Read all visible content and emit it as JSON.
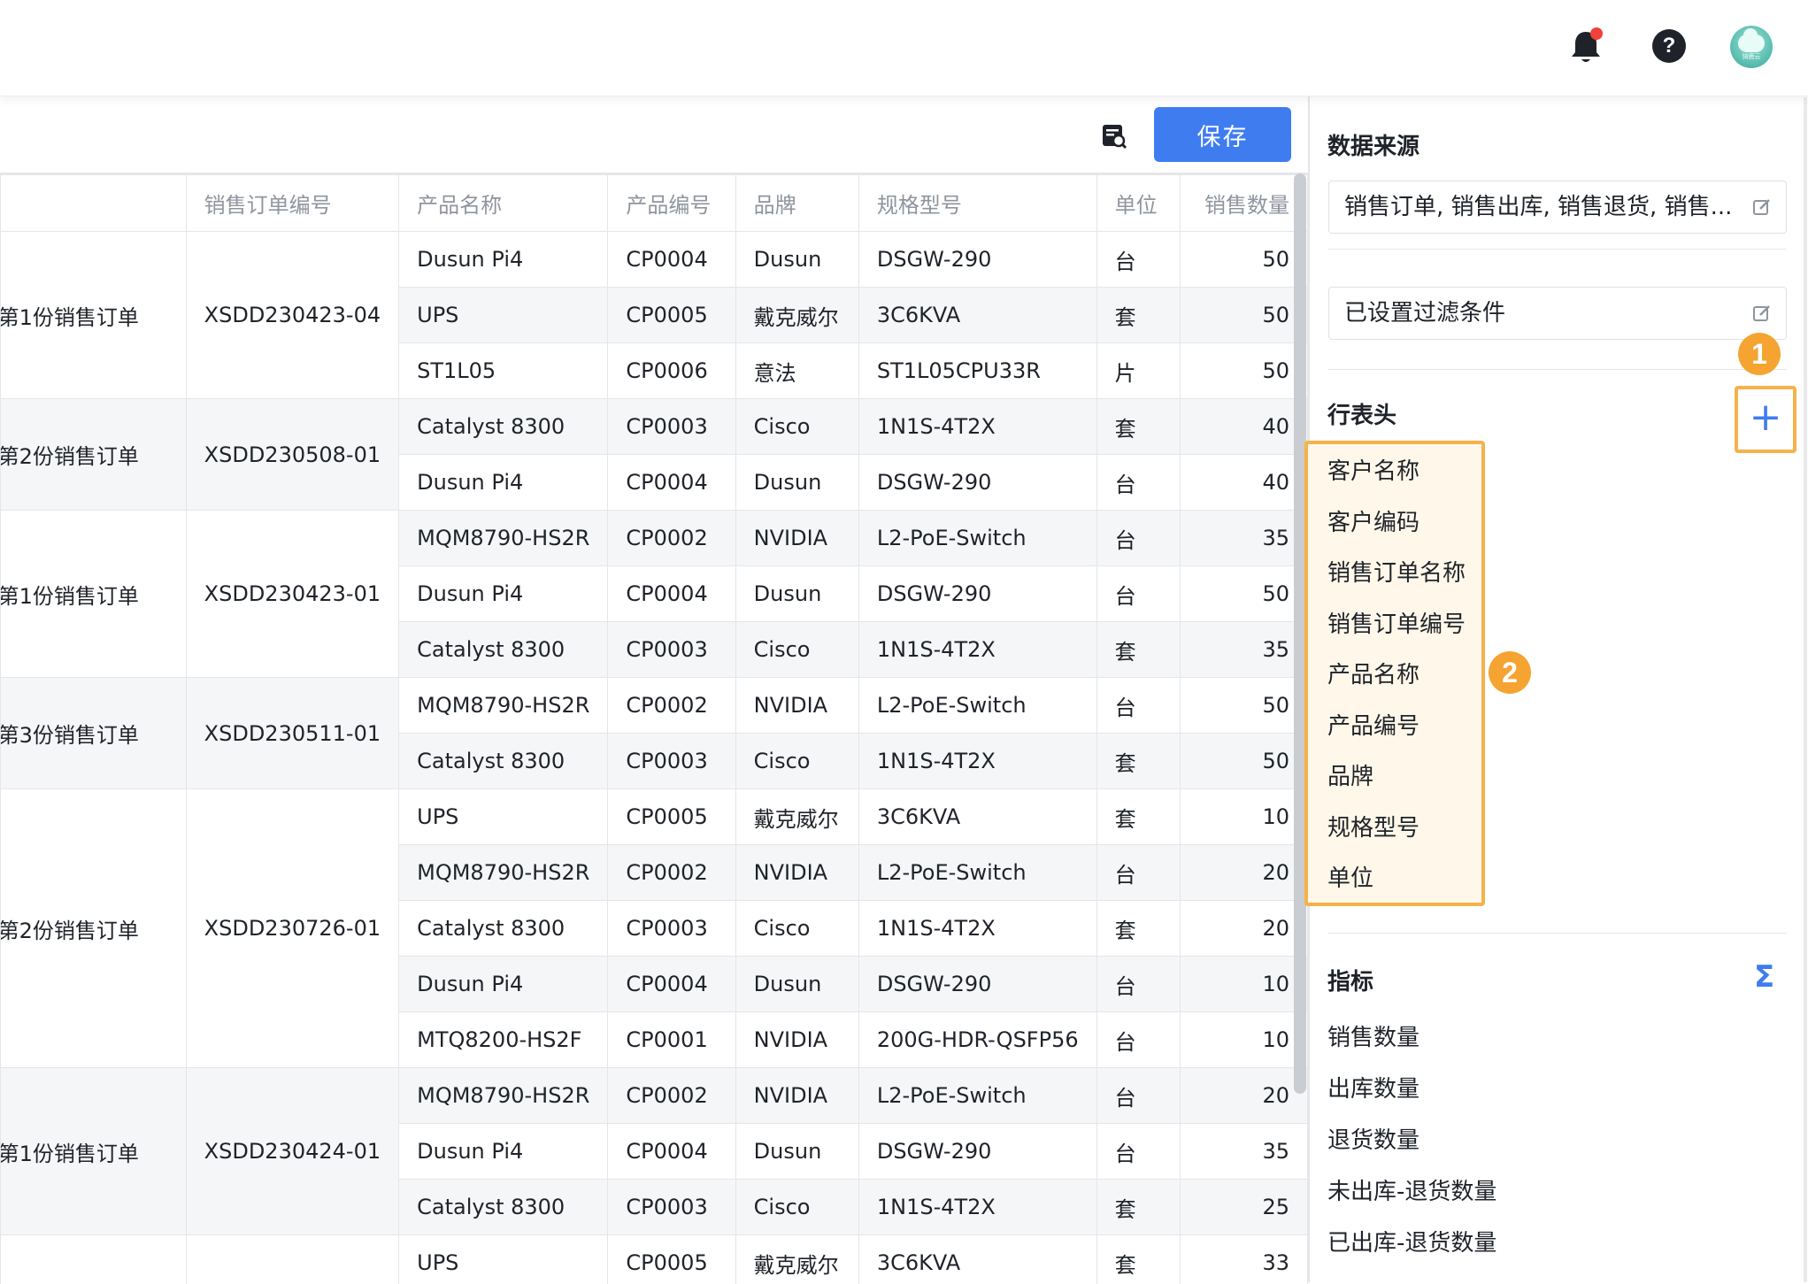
{
  "header": {
    "icons": [
      "bell-icon",
      "help-icon",
      "avatar"
    ],
    "help_glyph": "?",
    "avatar_text": "骑鹿云"
  },
  "toolbar": {
    "save_label": "保存"
  },
  "table": {
    "columns": [
      "",
      "销售订单编号",
      "产品名称",
      "产品编号",
      "品牌",
      "规格型号",
      "单位",
      "销售数量"
    ],
    "groups": [
      {
        "customer": "-第1份销售订单",
        "order_no": "XSDD230423-04",
        "rows": [
          [
            "Dusun Pi4",
            "CP0004",
            "Dusun",
            "DSGW-290",
            "台",
            "50"
          ],
          [
            "UPS",
            "CP0005",
            "戴克威尔",
            "3C6KVA",
            "套",
            "50"
          ],
          [
            "ST1L05",
            "CP0006",
            "意法",
            "ST1L05CPU33R",
            "片",
            "50"
          ]
        ]
      },
      {
        "customer": "-第2份销售订单",
        "order_no": "XSDD230508-01",
        "rows": [
          [
            "Catalyst 8300",
            "CP0003",
            "Cisco",
            "1N1S-4T2X",
            "套",
            "40"
          ],
          [
            "Dusun Pi4",
            "CP0004",
            "Dusun",
            "DSGW-290",
            "台",
            "40"
          ]
        ]
      },
      {
        "customer": "-第1份销售订单",
        "order_no": "XSDD230423-01",
        "rows": [
          [
            "MQM8790-HS2R",
            "CP0002",
            "NVIDIA",
            "L2-PoE-Switch",
            "台",
            "35"
          ],
          [
            "Dusun Pi4",
            "CP0004",
            "Dusun",
            "DSGW-290",
            "台",
            "50"
          ],
          [
            "Catalyst 8300",
            "CP0003",
            "Cisco",
            "1N1S-4T2X",
            "套",
            "35"
          ]
        ]
      },
      {
        "customer": "-第3份销售订单",
        "order_no": "XSDD230511-01",
        "rows": [
          [
            "MQM8790-HS2R",
            "CP0002",
            "NVIDIA",
            "L2-PoE-Switch",
            "台",
            "50"
          ],
          [
            "Catalyst 8300",
            "CP0003",
            "Cisco",
            "1N1S-4T2X",
            "套",
            "50"
          ]
        ]
      },
      {
        "customer": "-第2份销售订单",
        "order_no": "XSDD230726-01",
        "rows": [
          [
            "UPS",
            "CP0005",
            "戴克威尔",
            "3C6KVA",
            "套",
            "10"
          ],
          [
            "MQM8790-HS2R",
            "CP0002",
            "NVIDIA",
            "L2-PoE-Switch",
            "台",
            "20"
          ],
          [
            "Catalyst 8300",
            "CP0003",
            "Cisco",
            "1N1S-4T2X",
            "套",
            "20"
          ],
          [
            "Dusun Pi4",
            "CP0004",
            "Dusun",
            "DSGW-290",
            "台",
            "10"
          ],
          [
            "MTQ8200-HS2F",
            "CP0001",
            "NVIDIA",
            "200G-HDR-QSFP56",
            "台",
            "10"
          ]
        ]
      },
      {
        "customer": "-第1份销售订单",
        "order_no": "XSDD230424-01",
        "rows": [
          [
            "MQM8790-HS2R",
            "CP0002",
            "NVIDIA",
            "L2-PoE-Switch",
            "台",
            "20"
          ],
          [
            "Dusun Pi4",
            "CP0004",
            "Dusun",
            "DSGW-290",
            "台",
            "35"
          ],
          [
            "Catalyst 8300",
            "CP0003",
            "Cisco",
            "1N1S-4T2X",
            "套",
            "25"
          ]
        ]
      },
      {
        "customer": "",
        "order_no": "",
        "rows": [
          [
            "UPS",
            "CP0005",
            "戴克威尔",
            "3C6KVA",
            "套",
            "33"
          ]
        ]
      }
    ]
  },
  "panel": {
    "data_source": {
      "title": "数据来源",
      "value": "销售订单, 销售出库, 销售退货, 销售..."
    },
    "filter": {
      "value": "已设置过滤条件"
    },
    "row_header": {
      "title": "行表头",
      "add_glyph": "+",
      "items": [
        "客户名称",
        "客户编码",
        "销售订单名称",
        "销售订单编号",
        "产品名称",
        "产品编号",
        "品牌",
        "规格型号",
        "单位"
      ]
    },
    "metrics": {
      "title": "指标",
      "sigma_glyph": "Σ",
      "items": [
        "销售数量",
        "出库数量",
        "退货数量",
        "未出库-退货数量",
        "已出库-退货数量"
      ]
    },
    "annotations": {
      "badge1": "1",
      "badge2": "2",
      "color": "#f5a431"
    }
  },
  "colors": {
    "primary": "#3f7cf0",
    "annotation": "#f6b24a",
    "row_alt": "#f5f6f8",
    "notification_dot": "#f0413b"
  }
}
